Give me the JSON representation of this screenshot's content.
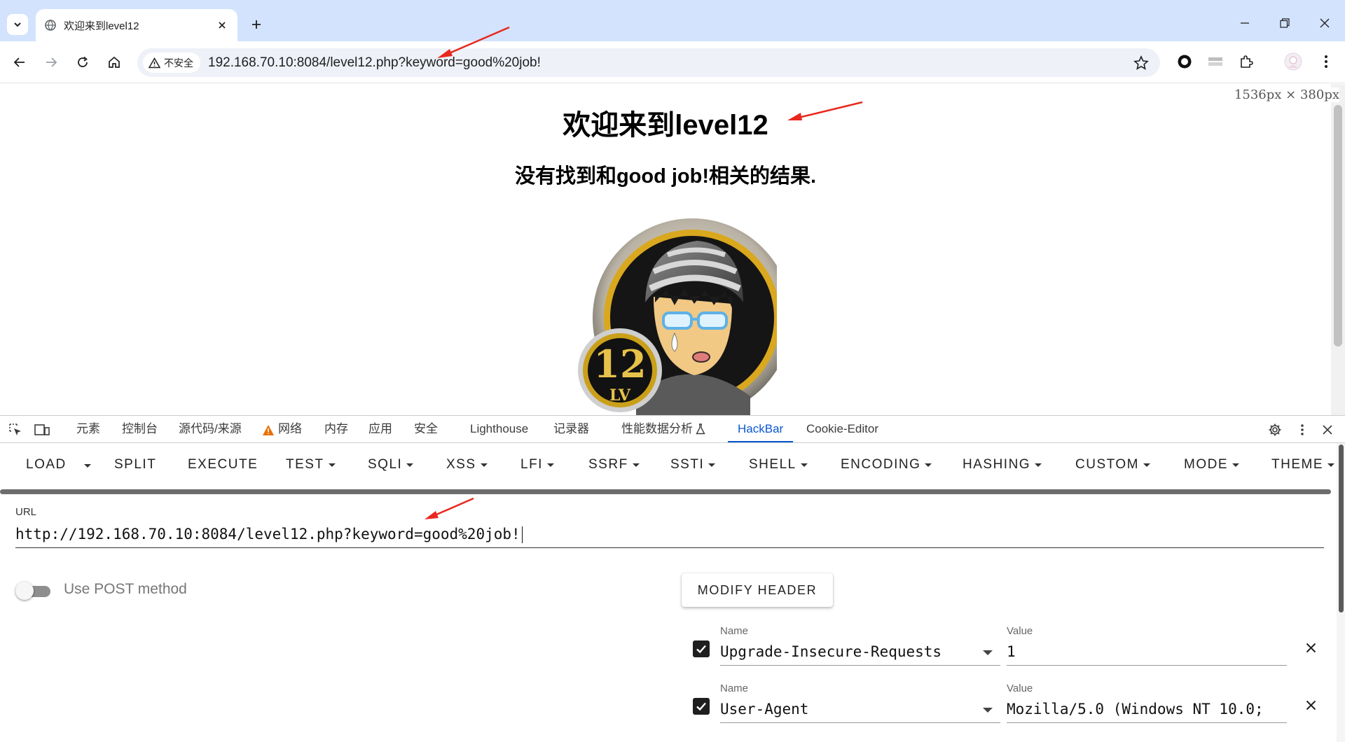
{
  "browser": {
    "tab": {
      "title": "欢迎来到level12"
    },
    "address_bar": {
      "security_label": "不安全",
      "url": "192.168.70.10:8084/level12.php?keyword=good%20job!"
    }
  },
  "page": {
    "viewport_size_label": "1536px × 380px",
    "heading": "欢迎来到level12",
    "message": "没有找到和good job!相关的结果.",
    "image_badge": {
      "number": "12",
      "suffix": "LV"
    }
  },
  "devtools": {
    "tabs": [
      {
        "label": "元素"
      },
      {
        "label": "控制台"
      },
      {
        "label": "源代码/来源"
      },
      {
        "label": "网络"
      },
      {
        "label": "内存"
      },
      {
        "label": "应用"
      },
      {
        "label": "安全"
      },
      {
        "label": "Lighthouse"
      },
      {
        "label": "记录器"
      },
      {
        "label": "性能数据分析"
      },
      {
        "label": "HackBar"
      },
      {
        "label": "Cookie-Editor"
      }
    ],
    "active_tab": "HackBar"
  },
  "hackbar": {
    "menu": {
      "load": "LOAD",
      "split": "SPLIT",
      "execute": "EXECUTE",
      "test": "TEST",
      "sqli": "SQLI",
      "xss": "XSS",
      "lfi": "LFI",
      "ssrf": "SSRF",
      "ssti": "SSTI",
      "shell": "SHELL",
      "encoding": "ENCODING",
      "hashing": "HASHING",
      "custom": "CUSTOM",
      "mode": "MODE",
      "theme": "THEME"
    },
    "url_label": "URL",
    "url_value": "http://192.168.70.10:8084/level12.php?keyword=good%20job!",
    "post_toggle_label": "Use POST method",
    "modify_header_label": "MODIFY HEADER",
    "headers": [
      {
        "name_label": "Name",
        "value_label": "Value",
        "name": "Upgrade-Insecure-Requests",
        "value": "1",
        "checked": true
      },
      {
        "name_label": "Name",
        "value_label": "Value",
        "name": "User-Agent",
        "value": "Mozilla/5.0 (Windows NT 10.0;",
        "checked": true
      }
    ]
  },
  "colors": {
    "tabstrip": "#d3e3fd",
    "devtools_active": "#0b57d0",
    "annotation_arrow": "#e8281e",
    "warning": "#e8710a"
  }
}
